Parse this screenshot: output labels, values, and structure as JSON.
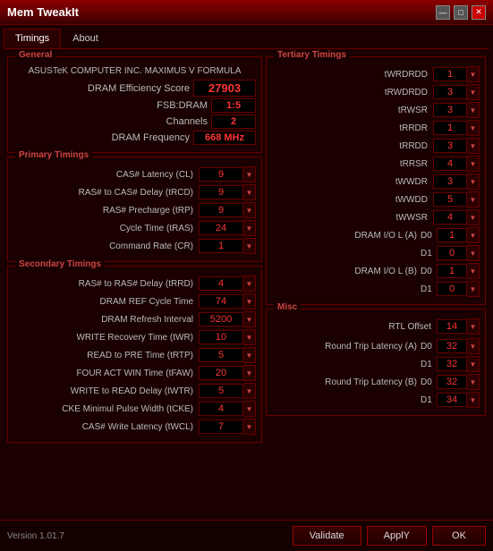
{
  "window": {
    "title": "Mem TweakIt",
    "minimize_label": "—",
    "maximize_label": "□",
    "close_label": "✕"
  },
  "tabs": [
    {
      "id": "timings",
      "label": "Timings",
      "active": true
    },
    {
      "id": "about",
      "label": "About",
      "active": false
    }
  ],
  "general": {
    "title": "General",
    "mobo": "ASUSTeK COMPUTER INC. MAXIMUS V FORMULA",
    "dram_score_label": "DRAM Efficiency Score",
    "dram_score": "27903",
    "fsb_dram_label": "FSB:DRAM",
    "fsb_dram": "1:5",
    "channels_label": "Channels",
    "channels": "2",
    "dram_freq_label": "DRAM Frequency",
    "dram_freq": "668 MHz"
  },
  "primary": {
    "title": "Primary Timings",
    "rows": [
      {
        "label": "CAS# Latency (CL)",
        "value": "9"
      },
      {
        "label": "RAS# to CAS# Delay (tRCD)",
        "value": "9"
      },
      {
        "label": "RAS# Precharge (tRP)",
        "value": "9"
      },
      {
        "label": "Cycle Time (tRAS)",
        "value": "24"
      },
      {
        "label": "Command Rate (CR)",
        "value": "1"
      }
    ]
  },
  "secondary": {
    "title": "Secondary Timings",
    "rows": [
      {
        "label": "RAS# to RAS# Delay (tRRD)",
        "value": "4"
      },
      {
        "label": "DRAM REF Cycle Time",
        "value": "74"
      },
      {
        "label": "DRAM Refresh Interval",
        "value": "5200"
      },
      {
        "label": "WRITE Recovery Time (tWR)",
        "value": "10"
      },
      {
        "label": "READ to PRE Time (tRTP)",
        "value": "5"
      },
      {
        "label": "FOUR ACT WIN Time (tFAW)",
        "value": "20"
      },
      {
        "label": "WRITE to READ Delay (tWTR)",
        "value": "5"
      },
      {
        "label": "CKE Minimul Pulse Width (tCKE)",
        "value": "4"
      },
      {
        "label": "CAS# Write Latency (tWCL)",
        "value": "7"
      }
    ]
  },
  "tertiary": {
    "title": "Tertiary Timings",
    "rows": [
      {
        "label": "tWRDRDD",
        "value": "1"
      },
      {
        "label": "tRWDRDD",
        "value": "3"
      },
      {
        "label": "tRWSR",
        "value": "3"
      },
      {
        "label": "tRRDR",
        "value": "1"
      },
      {
        "label": "tRRDD",
        "value": "3"
      },
      {
        "label": "tRRSR",
        "value": "4"
      },
      {
        "label": "tWWDR",
        "value": "3"
      },
      {
        "label": "tWWDD",
        "value": "5"
      },
      {
        "label": "tWWSR",
        "value": "4"
      }
    ],
    "dram_io_a": {
      "label": "DRAM I/O L (A)",
      "d0": "1",
      "d1": "0"
    },
    "dram_io_b": {
      "label": "DRAM I/O L (B)",
      "d0": "1",
      "d1": "0"
    }
  },
  "misc": {
    "title": "Misc",
    "rtl_offset_label": "RTL Offset",
    "rtl_offset": "14",
    "rtl_a_label": "Round Trip Latency (A)",
    "rtl_a_d0": "32",
    "rtl_a_d1": "32",
    "rtl_b_label": "Round Trip Latency (B)",
    "rtl_b_d0": "32",
    "rtl_b_d1": "34"
  },
  "buttons": {
    "validate": "Validate",
    "apply": "ApplY",
    "ok": "OK"
  },
  "version": "Version 1.01.7"
}
